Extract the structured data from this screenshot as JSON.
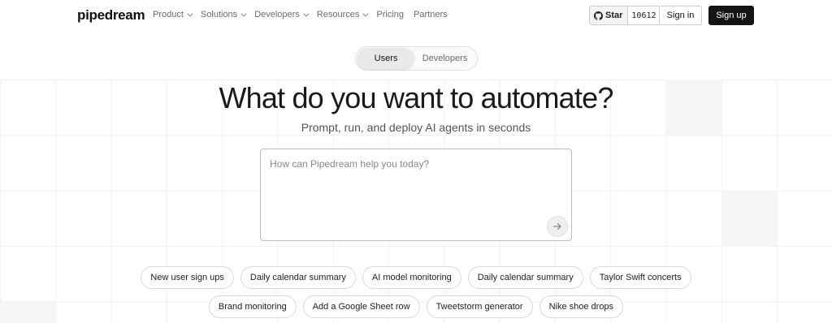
{
  "nav": {
    "logo": "pipedream",
    "links": [
      {
        "label": "Product",
        "dropdown": true
      },
      {
        "label": "Solutions",
        "dropdown": true
      },
      {
        "label": "Developers",
        "dropdown": true
      },
      {
        "label": "Resources",
        "dropdown": true
      },
      {
        "label": "Pricing",
        "dropdown": false
      },
      {
        "label": "Partners",
        "dropdown": false
      }
    ],
    "star_label": "Star",
    "star_count": "10612",
    "signin_label": "Sign in",
    "signup_label": "Sign up"
  },
  "toggle": {
    "options": [
      "Users",
      "Developers"
    ],
    "active": "Users"
  },
  "hero": {
    "title": "What do you want to automate?",
    "subtitle": "Prompt, run, and deploy AI agents in seconds"
  },
  "prompt": {
    "placeholder": "How can Pipedream help you today?",
    "value": "",
    "send_icon": "arrow-right-icon"
  },
  "suggestions": {
    "row1": [
      "New user sign ups",
      "Daily calendar summary",
      "AI model monitoring",
      "Daily calendar summary",
      "Taylor Swift concerts"
    ],
    "row2": [
      "Brand monitoring",
      "Add a Google Sheet row",
      "Tweetstorm generator",
      "Nike shoe drops"
    ]
  },
  "colors": {
    "accent": "#141414",
    "background": "#ffffff",
    "muted_text": "#6b6b6b",
    "border": "#d9d9d9"
  }
}
